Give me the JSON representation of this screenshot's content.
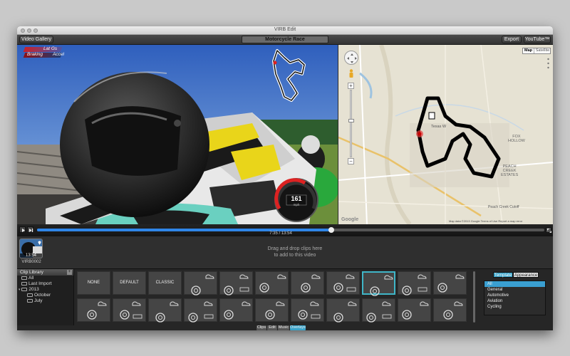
{
  "window": {
    "title": "VIRB Edit"
  },
  "toolbar": {
    "video_gallery": "Video Gallery",
    "project_title": "Motorcycle Race",
    "export": "Export",
    "youtube": "YouTube™"
  },
  "overlay": {
    "lat_label": "Lat Gs",
    "braking_label": "Braking",
    "accel_label": "Accel",
    "speed": "161",
    "speed_unit": "mph"
  },
  "map": {
    "map_tab": "Map",
    "satellite_tab": "Satellite",
    "labels": {
      "texas": "Texas",
      "texas2": "W",
      "fox": "FOX",
      "hollow": "HOLLOW",
      "peach1": "PEACH",
      "peach2": "CREEK",
      "peach3": "ESTATES",
      "cutoff": "Peach Creek Cutoff",
      "google": "Google",
      "attrib": "Map data ©2013 Google   Terms of Use   Report a map error"
    },
    "zoom_in": "+",
    "zoom_out": "−"
  },
  "scrub": {
    "timecode": "7:35 / 13:54",
    "progress": 0.58
  },
  "clips": {
    "thumb_duration": "13:54",
    "name": "VIRB0002",
    "drop_hint_line1": "Drag and drop clips here",
    "drop_hint_line2": "to add to this video"
  },
  "library": {
    "title": "Clip Library",
    "add": "+",
    "items": [
      "All",
      "Last Import",
      "2013",
      "October",
      "July"
    ]
  },
  "tiles": {
    "none": "NONE",
    "default": "DEFAULT",
    "classic": "CLASSIC"
  },
  "templates": {
    "seg_template": "Template",
    "seg_appearance": "Appearance",
    "items": [
      "All",
      "General",
      "Automotive",
      "Aviation",
      "Cycling"
    ],
    "selected": 0
  },
  "bottom_tabs": [
    "Clips",
    "Edit",
    "Music",
    "Overlays"
  ],
  "colors": {
    "accent": "#3aa3c9",
    "progress": "#2f86e8",
    "selected_tile": "#3fb6c8"
  }
}
